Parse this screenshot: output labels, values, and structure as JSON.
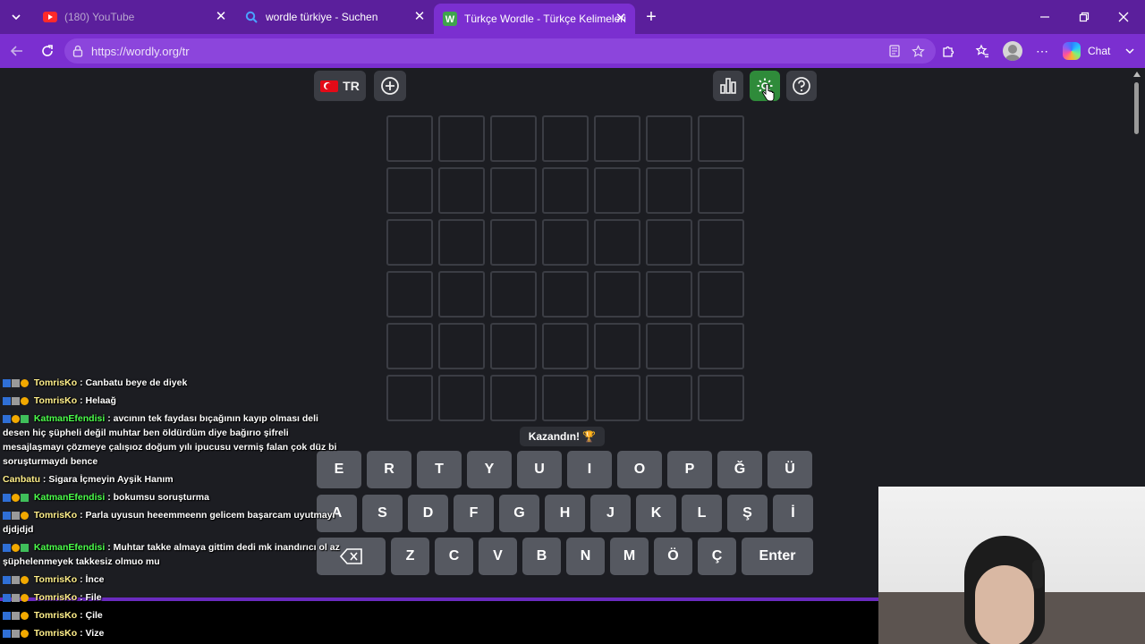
{
  "browser": {
    "tabs": [
      {
        "title": "(180) YouTube",
        "favicon": "youtube-icon"
      },
      {
        "title": "wordle türkiye - Suchen",
        "favicon": "search-icon"
      },
      {
        "title": "Türkçe Wordle - Türkçe Kelimeleri",
        "favicon": "wordle-w-icon"
      }
    ],
    "url": "https://wordly.org/tr",
    "chat_label": "Chat"
  },
  "game": {
    "language_label": "TR",
    "toast": "Kazandın! 🏆",
    "keyboard": {
      "row1": [
        "E",
        "R",
        "T",
        "Y",
        "U",
        "I",
        "O",
        "P",
        "Ğ",
        "Ü"
      ],
      "row2": [
        "A",
        "S",
        "D",
        "F",
        "G",
        "H",
        "J",
        "K",
        "L",
        "Ş",
        "İ"
      ],
      "row3": [
        "Z",
        "C",
        "V",
        "B",
        "N",
        "M",
        "Ö",
        "Ç"
      ],
      "enter_label": "Enter"
    }
  },
  "chat": [
    {
      "user": "TomrisKo",
      "text": ": Canbatu beye de diyek"
    },
    {
      "user": "TomrisKo",
      "text": ": Helaağ"
    },
    {
      "user": "KatmanEfendisi",
      "text": ": avcının tek faydası bıçağının kayıp olması deli desen hiç şüpheli değil muhtar ben öldürdüm diye bağırıo şifreli mesajlaşmayı çözmeye çalışıoz doğum yılı ipucusu vermiş falan çok düz bi soruşturmaydı bence"
    },
    {
      "user": "Canbatu",
      "text": ": Sigara İçmeyin Ayşik Hanım"
    },
    {
      "user": "KatmanEfendisi",
      "text": ": bokumsu soruşturma"
    },
    {
      "user": "TomrisKo",
      "text": ": Parla uyusun heeemmeenn gelicem başarcam uyutmayı djdjdjd"
    },
    {
      "user": "KatmanEfendisi",
      "text": ": Muhtar takke almaya gittim dedi mk inandırıcı ol az şüphelenmeyek takkesiz olmuo mu"
    },
    {
      "user": "TomrisKo",
      "text": ": İnce"
    },
    {
      "user": "TomrisKo",
      "text": ": File"
    },
    {
      "user": "TomrisKo",
      "text": ": Çile"
    },
    {
      "user": "TomrisKo",
      "text": ": Vize"
    }
  ]
}
